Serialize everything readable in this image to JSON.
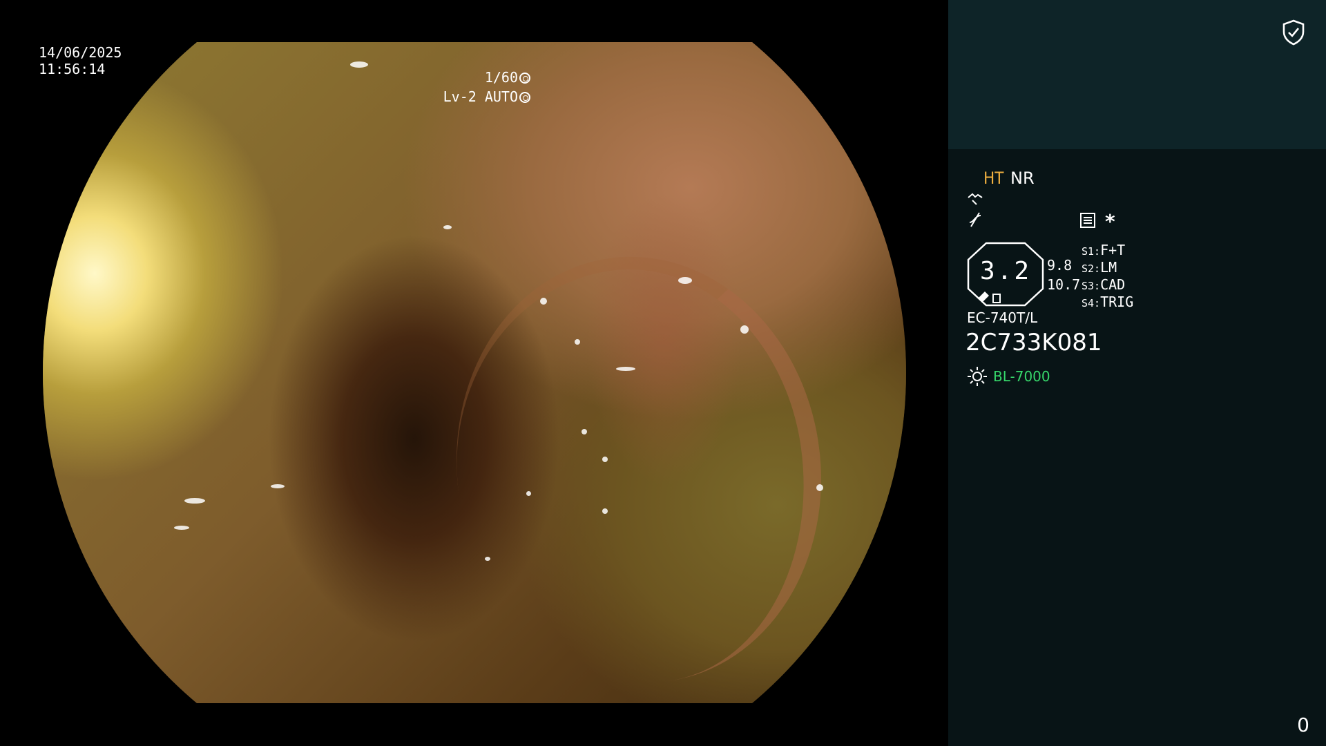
{
  "image_overlay": {
    "date": "14/06/2025",
    "time": "11:56:14",
    "shutter": "1/60",
    "level_mode": "Lv-2 AUTO"
  },
  "panel": {
    "enhance": {
      "ht": "HT",
      "nr": "NR"
    },
    "icons": {
      "structure": "structure-enhance-icon",
      "color": "color-enhance-icon",
      "settings": "settings-icon",
      "asterisk": "*",
      "shield": "shield-check-icon",
      "light": "light-source-icon"
    },
    "zoom": {
      "value": "3.2",
      "a": "9.8",
      "b": "10.7"
    },
    "switches": [
      {
        "key": "S1:",
        "value": "F+T"
      },
      {
        "key": "S2:",
        "value": "LM"
      },
      {
        "key": "S3:",
        "value": "CAD"
      },
      {
        "key": "S4:",
        "value": "TRIG"
      }
    ],
    "scope_model": "EC-740T/L",
    "scope_serial": "2C733K081",
    "light_source": "BL-7000",
    "counter": "0"
  },
  "colors": {
    "panel_top": "#0e2428",
    "panel_body": "#081416",
    "ht_accent": "#f0b040",
    "light_accent": "#36d66a"
  }
}
